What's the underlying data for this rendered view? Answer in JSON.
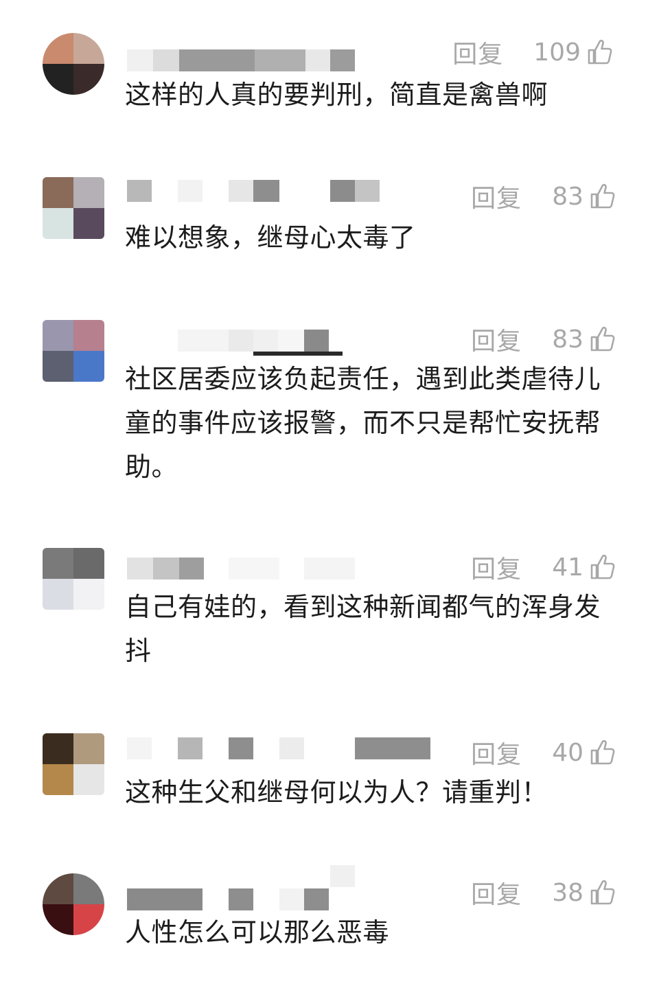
{
  "comments": [
    {
      "reply_label": "回复",
      "likes": "109",
      "text": "这样的人真的要判刑，简直是禽兽啊",
      "avatar_colors": [
        "#a8a7a6",
        "#555555",
        "#c98a6e",
        "#c7a898",
        "#222222",
        "#3a2a2a"
      ]
    },
    {
      "reply_label": "回复",
      "likes": "83",
      "text": "难以想象，继母心太毒了",
      "avatar_colors": [
        "#8a6a58",
        "#b4b0b5",
        "#d8e4e2",
        "#5a4a5e"
      ]
    },
    {
      "reply_label": "回复",
      "likes": "83",
      "text": "社区居委应该负起责任，遇到此类虐待儿童的事件应该报警，而不只是帮忙安抚帮助。",
      "avatar_colors": [
        "#9a96ae",
        "#b6808f",
        "#5c6070",
        "#4a78c9"
      ]
    },
    {
      "reply_label": "回复",
      "likes": "41",
      "text": "自己有娃的，看到这种新闻都气的浑身发抖",
      "avatar_colors": [
        "#7a7a7a",
        "#6a6a6a",
        "#dadde4",
        "#f2f2f4"
      ]
    },
    {
      "reply_label": "回复",
      "likes": "40",
      "text": "这种生父和继母何以为人？请重判！",
      "avatar_colors": [
        "#3a2c1e",
        "#b09a7e",
        "#b4884a",
        "#e6e6e6"
      ]
    },
    {
      "reply_label": "回复",
      "likes": "38",
      "text": "人性怎么可以那么恶毒",
      "avatar_colors": [
        "#5e4a40",
        "#7a7a7a",
        "#3a0f12",
        "#d64448"
      ]
    }
  ]
}
